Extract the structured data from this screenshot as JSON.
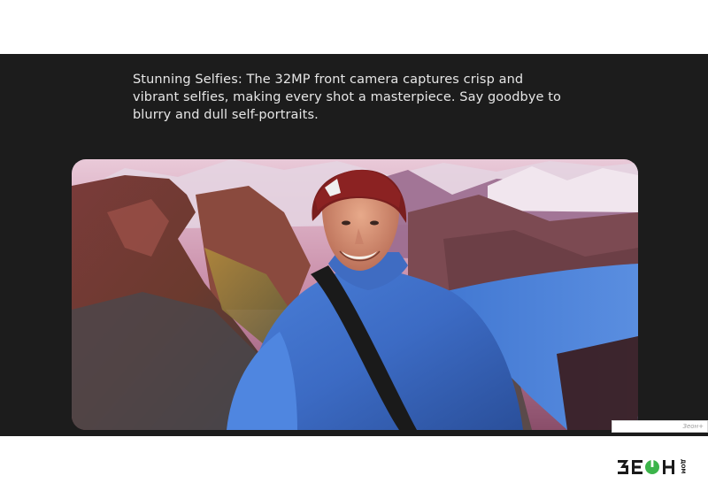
{
  "headline": {
    "text": "Stunning Selfies: The 32MP front camera captures crisp and vibrant selfies, making every shot a masterpiece. Say goodbye to blurry and dull self-portraits."
  },
  "photo": {
    "alt": "Smiling hiker in a blue jacket and red beanie taking a selfie on a mountain ridge at sunset"
  },
  "watermark": {
    "text": "Зеон+"
  },
  "brand": {
    "name": "ЗЕОН",
    "tagline": "ДОМ",
    "color_text": "#1a1a1a",
    "color_accent": "#3cb44a"
  },
  "colors": {
    "band_background": "#1c1c1c",
    "headline_text": "#e6e6e6"
  }
}
